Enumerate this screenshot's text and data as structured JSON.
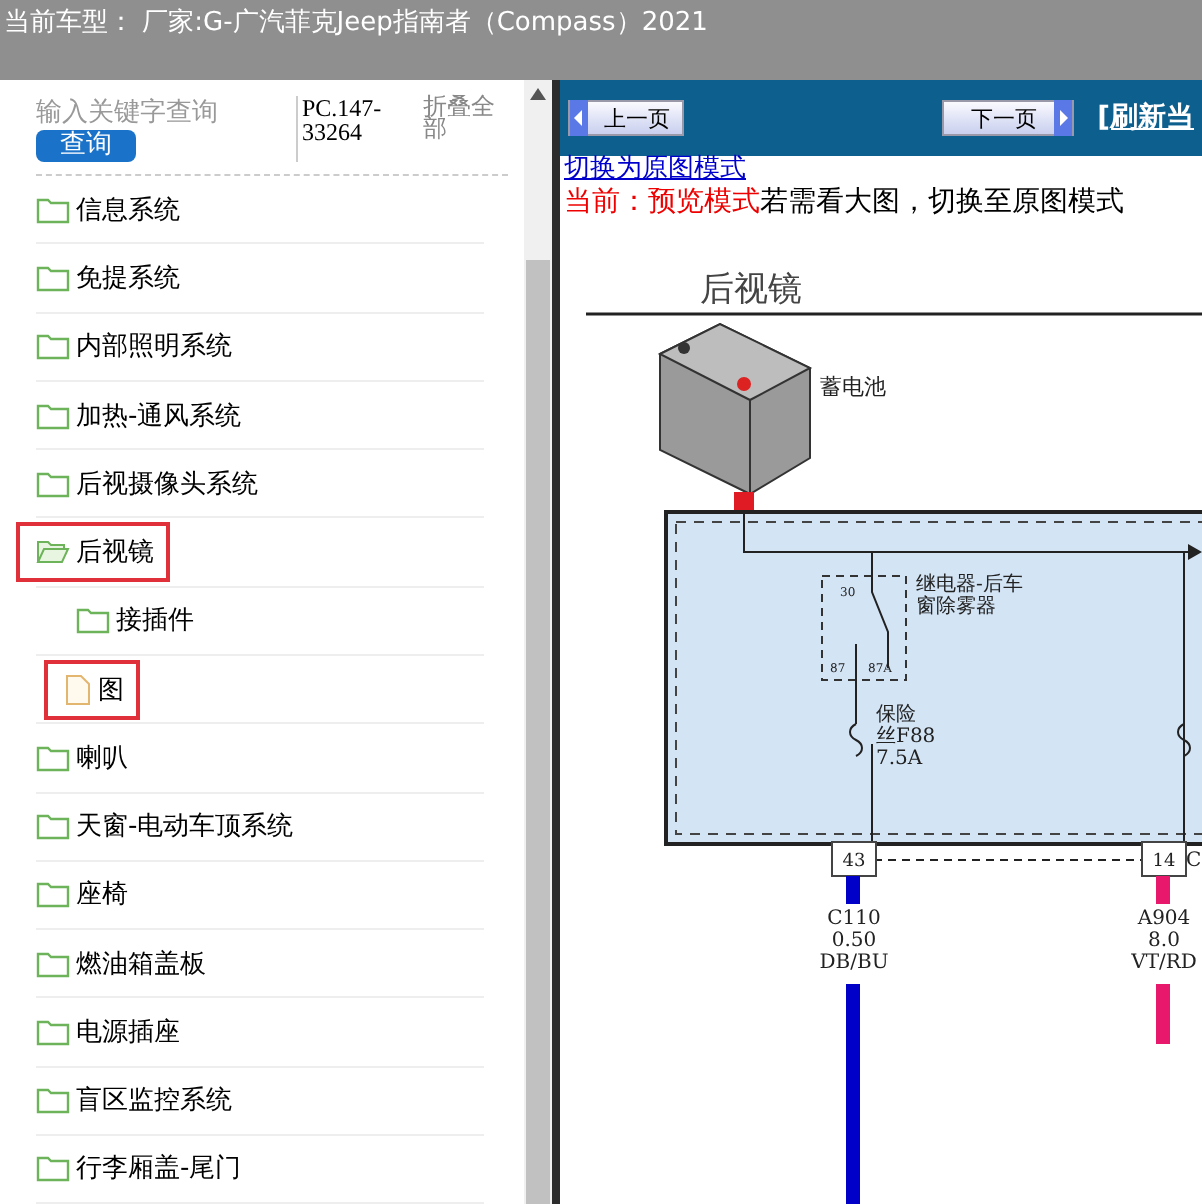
{
  "header": {
    "title": "当前车型： 厂家:G-广汽菲克Jeep指南者（Compass）2021"
  },
  "sidebar": {
    "search": {
      "placeholder": "输入关键字查询",
      "button": "查询"
    },
    "code": "PC.147-33264",
    "collapse_all": "折叠全部",
    "tree": [
      {
        "label": "信息系统",
        "expanded": false,
        "highlighted": false
      },
      {
        "label": "免提系统",
        "expanded": false,
        "highlighted": false
      },
      {
        "label": "内部照明系统",
        "expanded": false,
        "highlighted": false
      },
      {
        "label": "加热-通风系统",
        "expanded": false,
        "highlighted": false
      },
      {
        "label": "后视摄像头系统",
        "expanded": false,
        "highlighted": false
      },
      {
        "label": "后视镜",
        "expanded": true,
        "highlighted": true,
        "children": [
          {
            "label": "接插件",
            "kind": "folder",
            "highlighted": false
          },
          {
            "label": "图",
            "kind": "page",
            "highlighted": true
          }
        ]
      },
      {
        "label": "喇叭",
        "expanded": false,
        "highlighted": false
      },
      {
        "label": "天窗-电动车顶系统",
        "expanded": false,
        "highlighted": false
      },
      {
        "label": "座椅",
        "expanded": false,
        "highlighted": false
      },
      {
        "label": "燃油箱盖板",
        "expanded": false,
        "highlighted": false
      },
      {
        "label": "电源插座",
        "expanded": false,
        "highlighted": false
      },
      {
        "label": "盲区监控系统",
        "expanded": false,
        "highlighted": false
      },
      {
        "label": "行李厢盖-尾门",
        "expanded": false,
        "highlighted": false
      }
    ]
  },
  "toolbar": {
    "prev": "上一页",
    "next": "下一页",
    "refresh": "[刷新当"
  },
  "mode": {
    "link": "切换为原图模式",
    "current": "当前：预览模式",
    "hint": "若需看大图，切换至原图模式"
  },
  "diagram": {
    "title": "后视镜",
    "battery": "蓄电池",
    "relay": [
      "继电器-后车",
      "窗除雾器"
    ],
    "relay_pins": [
      "30",
      "87",
      "87A"
    ],
    "fuse": [
      "保险",
      "丝F88",
      "7.5A"
    ],
    "connectors": [
      {
        "pin": "43",
        "wire": [
          "C110",
          "0.50",
          "DB/BU"
        ]
      },
      {
        "pin": "14",
        "wire": [
          "A904",
          "8.0",
          "VT/RD"
        ]
      }
    ],
    "connector_suffix": "C"
  }
}
